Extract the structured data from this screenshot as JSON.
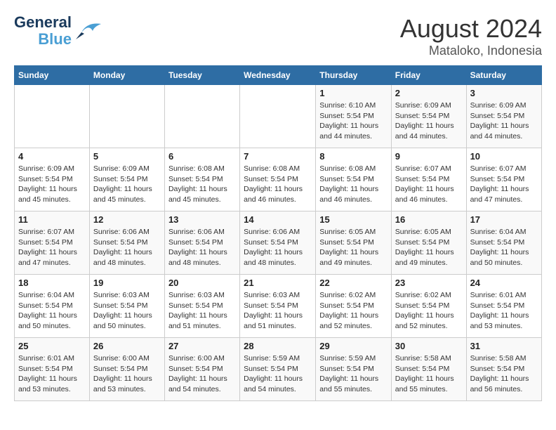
{
  "header": {
    "logo_line1": "General",
    "logo_line2": "Blue",
    "month": "August 2024",
    "location": "Mataloko, Indonesia"
  },
  "days_of_week": [
    "Sunday",
    "Monday",
    "Tuesday",
    "Wednesday",
    "Thursday",
    "Friday",
    "Saturday"
  ],
  "weeks": [
    [
      {
        "day": "",
        "info": ""
      },
      {
        "day": "",
        "info": ""
      },
      {
        "day": "",
        "info": ""
      },
      {
        "day": "",
        "info": ""
      },
      {
        "day": "1",
        "info": "Sunrise: 6:10 AM\nSunset: 5:54 PM\nDaylight: 11 hours and 44 minutes."
      },
      {
        "day": "2",
        "info": "Sunrise: 6:09 AM\nSunset: 5:54 PM\nDaylight: 11 hours and 44 minutes."
      },
      {
        "day": "3",
        "info": "Sunrise: 6:09 AM\nSunset: 5:54 PM\nDaylight: 11 hours and 44 minutes."
      }
    ],
    [
      {
        "day": "4",
        "info": "Sunrise: 6:09 AM\nSunset: 5:54 PM\nDaylight: 11 hours and 45 minutes."
      },
      {
        "day": "5",
        "info": "Sunrise: 6:09 AM\nSunset: 5:54 PM\nDaylight: 11 hours and 45 minutes."
      },
      {
        "day": "6",
        "info": "Sunrise: 6:08 AM\nSunset: 5:54 PM\nDaylight: 11 hours and 45 minutes."
      },
      {
        "day": "7",
        "info": "Sunrise: 6:08 AM\nSunset: 5:54 PM\nDaylight: 11 hours and 46 minutes."
      },
      {
        "day": "8",
        "info": "Sunrise: 6:08 AM\nSunset: 5:54 PM\nDaylight: 11 hours and 46 minutes."
      },
      {
        "day": "9",
        "info": "Sunrise: 6:07 AM\nSunset: 5:54 PM\nDaylight: 11 hours and 46 minutes."
      },
      {
        "day": "10",
        "info": "Sunrise: 6:07 AM\nSunset: 5:54 PM\nDaylight: 11 hours and 47 minutes."
      }
    ],
    [
      {
        "day": "11",
        "info": "Sunrise: 6:07 AM\nSunset: 5:54 PM\nDaylight: 11 hours and 47 minutes."
      },
      {
        "day": "12",
        "info": "Sunrise: 6:06 AM\nSunset: 5:54 PM\nDaylight: 11 hours and 48 minutes."
      },
      {
        "day": "13",
        "info": "Sunrise: 6:06 AM\nSunset: 5:54 PM\nDaylight: 11 hours and 48 minutes."
      },
      {
        "day": "14",
        "info": "Sunrise: 6:06 AM\nSunset: 5:54 PM\nDaylight: 11 hours and 48 minutes."
      },
      {
        "day": "15",
        "info": "Sunrise: 6:05 AM\nSunset: 5:54 PM\nDaylight: 11 hours and 49 minutes."
      },
      {
        "day": "16",
        "info": "Sunrise: 6:05 AM\nSunset: 5:54 PM\nDaylight: 11 hours and 49 minutes."
      },
      {
        "day": "17",
        "info": "Sunrise: 6:04 AM\nSunset: 5:54 PM\nDaylight: 11 hours and 50 minutes."
      }
    ],
    [
      {
        "day": "18",
        "info": "Sunrise: 6:04 AM\nSunset: 5:54 PM\nDaylight: 11 hours and 50 minutes."
      },
      {
        "day": "19",
        "info": "Sunrise: 6:03 AM\nSunset: 5:54 PM\nDaylight: 11 hours and 50 minutes."
      },
      {
        "day": "20",
        "info": "Sunrise: 6:03 AM\nSunset: 5:54 PM\nDaylight: 11 hours and 51 minutes."
      },
      {
        "day": "21",
        "info": "Sunrise: 6:03 AM\nSunset: 5:54 PM\nDaylight: 11 hours and 51 minutes."
      },
      {
        "day": "22",
        "info": "Sunrise: 6:02 AM\nSunset: 5:54 PM\nDaylight: 11 hours and 52 minutes."
      },
      {
        "day": "23",
        "info": "Sunrise: 6:02 AM\nSunset: 5:54 PM\nDaylight: 11 hours and 52 minutes."
      },
      {
        "day": "24",
        "info": "Sunrise: 6:01 AM\nSunset: 5:54 PM\nDaylight: 11 hours and 53 minutes."
      }
    ],
    [
      {
        "day": "25",
        "info": "Sunrise: 6:01 AM\nSunset: 5:54 PM\nDaylight: 11 hours and 53 minutes."
      },
      {
        "day": "26",
        "info": "Sunrise: 6:00 AM\nSunset: 5:54 PM\nDaylight: 11 hours and 53 minutes."
      },
      {
        "day": "27",
        "info": "Sunrise: 6:00 AM\nSunset: 5:54 PM\nDaylight: 11 hours and 54 minutes."
      },
      {
        "day": "28",
        "info": "Sunrise: 5:59 AM\nSunset: 5:54 PM\nDaylight: 11 hours and 54 minutes."
      },
      {
        "day": "29",
        "info": "Sunrise: 5:59 AM\nSunset: 5:54 PM\nDaylight: 11 hours and 55 minutes."
      },
      {
        "day": "30",
        "info": "Sunrise: 5:58 AM\nSunset: 5:54 PM\nDaylight: 11 hours and 55 minutes."
      },
      {
        "day": "31",
        "info": "Sunrise: 5:58 AM\nSunset: 5:54 PM\nDaylight: 11 hours and 56 minutes."
      }
    ]
  ]
}
